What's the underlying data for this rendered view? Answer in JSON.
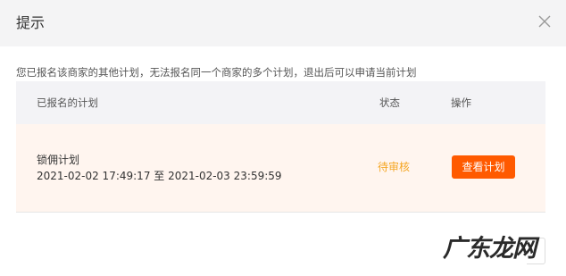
{
  "dialog": {
    "title": "提示",
    "close_icon": "close-icon"
  },
  "notice": "您已报名该商家的其他计划，无法报名同一个商家的多个计划，退出后可以申请当前计划",
  "table": {
    "headers": {
      "plan": "已报名的计划",
      "status": "状态",
      "action": "操作"
    },
    "rows": [
      {
        "name": "锁佣计划",
        "time": "2021-02-02 17:49:17 至 2021-02-03 23:59:59",
        "status": "待审核",
        "action_label": "查看计划"
      }
    ]
  },
  "watermark": "广东龙网",
  "colors": {
    "accent": "#ff5a00",
    "status_pending": "#f5a623",
    "row_highlight": "#fff5ef",
    "header_bg": "#f4f4f5"
  }
}
